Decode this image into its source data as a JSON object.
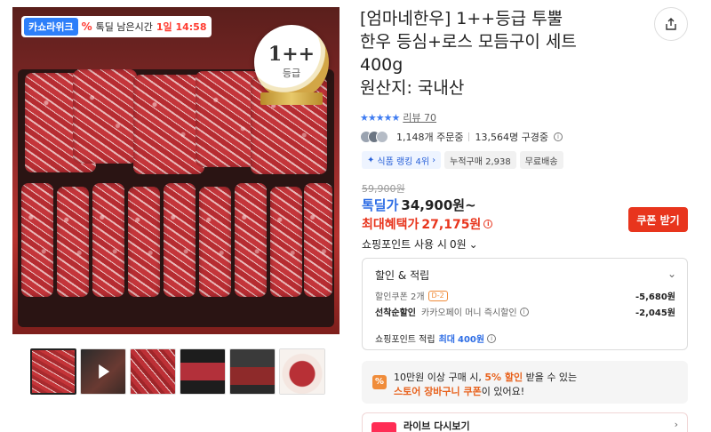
{
  "image": {
    "badge_brand": "카쇼라위크",
    "badge_label": "톡딜 남은시간",
    "badge_time": "1일 14:58",
    "grade_top": "1++",
    "grade_bottom": "등급"
  },
  "thumbnails": [
    {
      "name": "thumb-1",
      "selected": true
    },
    {
      "name": "thumb-2-video",
      "video": true
    },
    {
      "name": "thumb-3"
    },
    {
      "name": "thumb-4"
    },
    {
      "name": "thumb-5"
    },
    {
      "name": "thumb-6"
    }
  ],
  "product": {
    "title_line1": "[엄마네한우] 1++등급 투뿔",
    "title_line2": "한우 등심+로스 모듬구이 세트",
    "title_line3": "400g",
    "title_line4": "원산지: 국내산"
  },
  "rating": {
    "stars": "★★★★★",
    "review_label": "리뷰 70"
  },
  "stats": {
    "orders": "1,148개 주문중",
    "viewers": "13,564명 구경중"
  },
  "chips": {
    "ranking": "식품 랭킹 4위",
    "total_purchases": "누적구매 2,938",
    "free_shipping": "무료배송"
  },
  "price": {
    "original": "59,900원",
    "deal_label": "톡딜가",
    "deal_value": "34,900원~",
    "max_label": "최대혜택가",
    "max_value": "27,175원",
    "coupon_button": "쿠폰 받기",
    "points_label": "쇼핑포인트 사용 시",
    "points_value": "0원"
  },
  "discount": {
    "header": "할인 & 적립",
    "coupon_label": "할인쿠폰 2개",
    "coupon_tag": "D-2",
    "coupon_amount": "-5,680원",
    "first_label": "선착순할인",
    "first_desc": "카카오페이 머니 즉시할인",
    "first_amount": "-2,045원",
    "points_label": "쇼핑포인트 적립",
    "points_max_label": "최대",
    "points_max_value": "400원"
  },
  "promo": {
    "line1_pre": "10만원 이상 구매 시,",
    "line1_highlight": "5% 할인",
    "line1_post": "받을 수 있는",
    "line2_highlight": "스토어 장바구니 쿠폰",
    "line2_post": "이 있어요!"
  },
  "live": {
    "label": "라이브 다시보기"
  },
  "colors": {
    "accent_red": "#e8351d",
    "accent_blue": "#2f6ee5",
    "accent_orange": "#f08c3a"
  }
}
